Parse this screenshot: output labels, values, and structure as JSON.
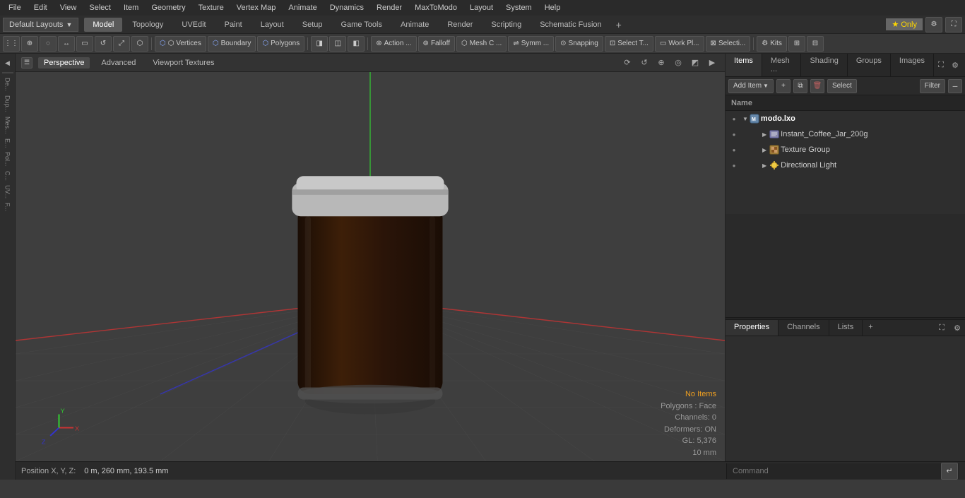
{
  "menubar": {
    "items": [
      "File",
      "Edit",
      "View",
      "Select",
      "Item",
      "Geometry",
      "Texture",
      "Vertex Map",
      "Animate",
      "Dynamics",
      "Render",
      "MaxToModo",
      "Layout",
      "System",
      "Help"
    ]
  },
  "layoutbar": {
    "dropdown": "Default Layouts",
    "tabs": [
      "Model",
      "Topology",
      "UVEdit",
      "Paint",
      "Layout",
      "Setup",
      "Game Tools",
      "Animate",
      "Render",
      "Scripting",
      "Schematic Fusion"
    ],
    "active_tab": "Model",
    "plus_label": "+",
    "star_label": "★  Only"
  },
  "toolbar": {
    "tools": [
      {
        "name": "dots-icon",
        "label": "⋮⋮"
      },
      {
        "name": "globe-icon",
        "label": "⊕"
      },
      {
        "name": "lasso-icon",
        "label": "◌"
      },
      {
        "name": "move-icon",
        "label": "↔"
      },
      {
        "name": "box-icon",
        "label": "▭"
      },
      {
        "name": "rotate-icon",
        "label": "↺"
      },
      {
        "name": "scale-icon",
        "label": "⤢"
      },
      {
        "name": "shield-icon",
        "label": "⬡"
      },
      {
        "name": "vertices-btn",
        "label": "⬡ Vertices"
      },
      {
        "name": "boundary-btn",
        "label": "⬡ Boundary"
      },
      {
        "name": "polygons-btn",
        "label": "⬡ Polygons"
      },
      {
        "name": "shading-btn",
        "label": "◨"
      },
      {
        "name": "wire1-btn",
        "label": "◫"
      },
      {
        "name": "wire2-btn",
        "label": "◧"
      },
      {
        "name": "action-btn",
        "label": "⊛ Action ..."
      },
      {
        "name": "falloff-btn",
        "label": "⊚ Falloff"
      },
      {
        "name": "mesh-c-btn",
        "label": "⬡ Mesh C ..."
      },
      {
        "name": "symm-btn",
        "label": "⇌ Symm ..."
      },
      {
        "name": "snapping-btn",
        "label": "⊙ Snapping"
      },
      {
        "name": "select-t-btn",
        "label": "⊡ Select T..."
      },
      {
        "name": "work-pl-btn",
        "label": "▭ Work Pl..."
      },
      {
        "name": "selecti-btn",
        "label": "⊠ Selecti..."
      },
      {
        "name": "kits-btn",
        "label": "⚙ Kits"
      },
      {
        "name": "view1-btn",
        "label": "⊞"
      },
      {
        "name": "view2-btn",
        "label": "⊟"
      }
    ]
  },
  "viewport": {
    "tabs": [
      "Perspective",
      "Advanced",
      "Viewport Textures"
    ],
    "active_tab": "Perspective",
    "controls": [
      "⟳",
      "↺",
      "⊕",
      "◎",
      "◩",
      "▶"
    ],
    "status": {
      "no_items": "No Items",
      "polygons": "Polygons : Face",
      "channels": "Channels: 0",
      "deformers": "Deformers: ON",
      "gl": "GL: 5,376",
      "mm": "10 mm"
    }
  },
  "left_sidebar": {
    "labels": [
      "De...",
      "Dup...",
      "Mes...",
      "E...",
      "Pol...",
      "C...",
      "UV...",
      "F..."
    ]
  },
  "right_panel": {
    "tabs": [
      "Items",
      "Mesh ...",
      "Shading",
      "Groups",
      "Images"
    ],
    "active_tab": "Items",
    "toolbar": {
      "add_item": "Add Item",
      "select": "Select",
      "filter": "Filter"
    },
    "name_col": "Name",
    "items": [
      {
        "id": "modo-lxo",
        "label": "modo.lxo",
        "level": 0,
        "icon": "lxo",
        "expanded": true,
        "eye": true
      },
      {
        "id": "instant-coffee",
        "label": "Instant_Coffee_Jar_200g",
        "level": 1,
        "icon": "mesh",
        "expanded": false,
        "eye": true
      },
      {
        "id": "texture-group",
        "label": "Texture Group",
        "level": 1,
        "icon": "texture",
        "expanded": false,
        "eye": true
      },
      {
        "id": "directional-light",
        "label": "Directional Light",
        "level": 1,
        "icon": "light",
        "expanded": false,
        "eye": true
      }
    ]
  },
  "properties_panel": {
    "tabs": [
      "Properties",
      "Channels",
      "Lists"
    ],
    "active_tab": "Properties",
    "plus_label": "+"
  },
  "bottom_bar": {
    "position_label": "Position X, Y, Z:",
    "position_value": "0 m, 260 mm, 193.5 mm",
    "command_placeholder": "Command",
    "go_btn": "↵"
  }
}
